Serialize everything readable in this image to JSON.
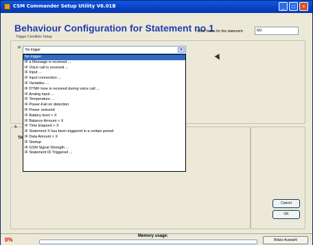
{
  "window": {
    "title": "CSM Commander Setup Utility V6.01B",
    "minimize_glyph": "_",
    "maximize_glyph": "□",
    "close_glyph": "×"
  },
  "header": {
    "title": "Behaviour Configuration for Statement no 1",
    "subtitle": "Trigger Condition Setup"
  },
  "short_name": {
    "label": "Short Name for this statement:",
    "value": "NO"
  },
  "condition": {
    "caption": "Trigger Condition Setup",
    "if_label": "IF",
    "selected": "No trigger",
    "dropdown_arrow": "▾",
    "options": [
      "No trigger",
      "IF a Message is received ...",
      "IF Voice call is received ...",
      "IF Input ...",
      "IF Input connection ...",
      "IF Variables ...",
      "IF DTMF tone is received during voice call ...",
      "IF Analog input ...",
      "IF Temperature ...",
      "IF Power-Fail on detection",
      "IF Power restored",
      "IF Battery level < X",
      "IF Balance Amount < X",
      "IF Time Elapsed > X",
      "IF Statement X has been triggered in a certain period",
      "IF Data Amount > X",
      "IF Startup",
      "IF GSM Signal Strength ...",
      "IF Statement ID Triggered ..."
    ]
  },
  "side_labels": {
    "a": "A",
    "b": "TH"
  },
  "buttons": {
    "cancel": "Cancel",
    "ok": "OK"
  },
  "status_bar": {
    "percent_text": "0%",
    "memory_label": "Memory usage:",
    "memory_fraction": 0.0,
    "status_button": "Bilanz Auswahl"
  },
  "colors": {
    "title_bar": "#0a3fc4",
    "header_text": "#1f3ab0",
    "selection": "#316ac5",
    "percent": "#e00000"
  }
}
